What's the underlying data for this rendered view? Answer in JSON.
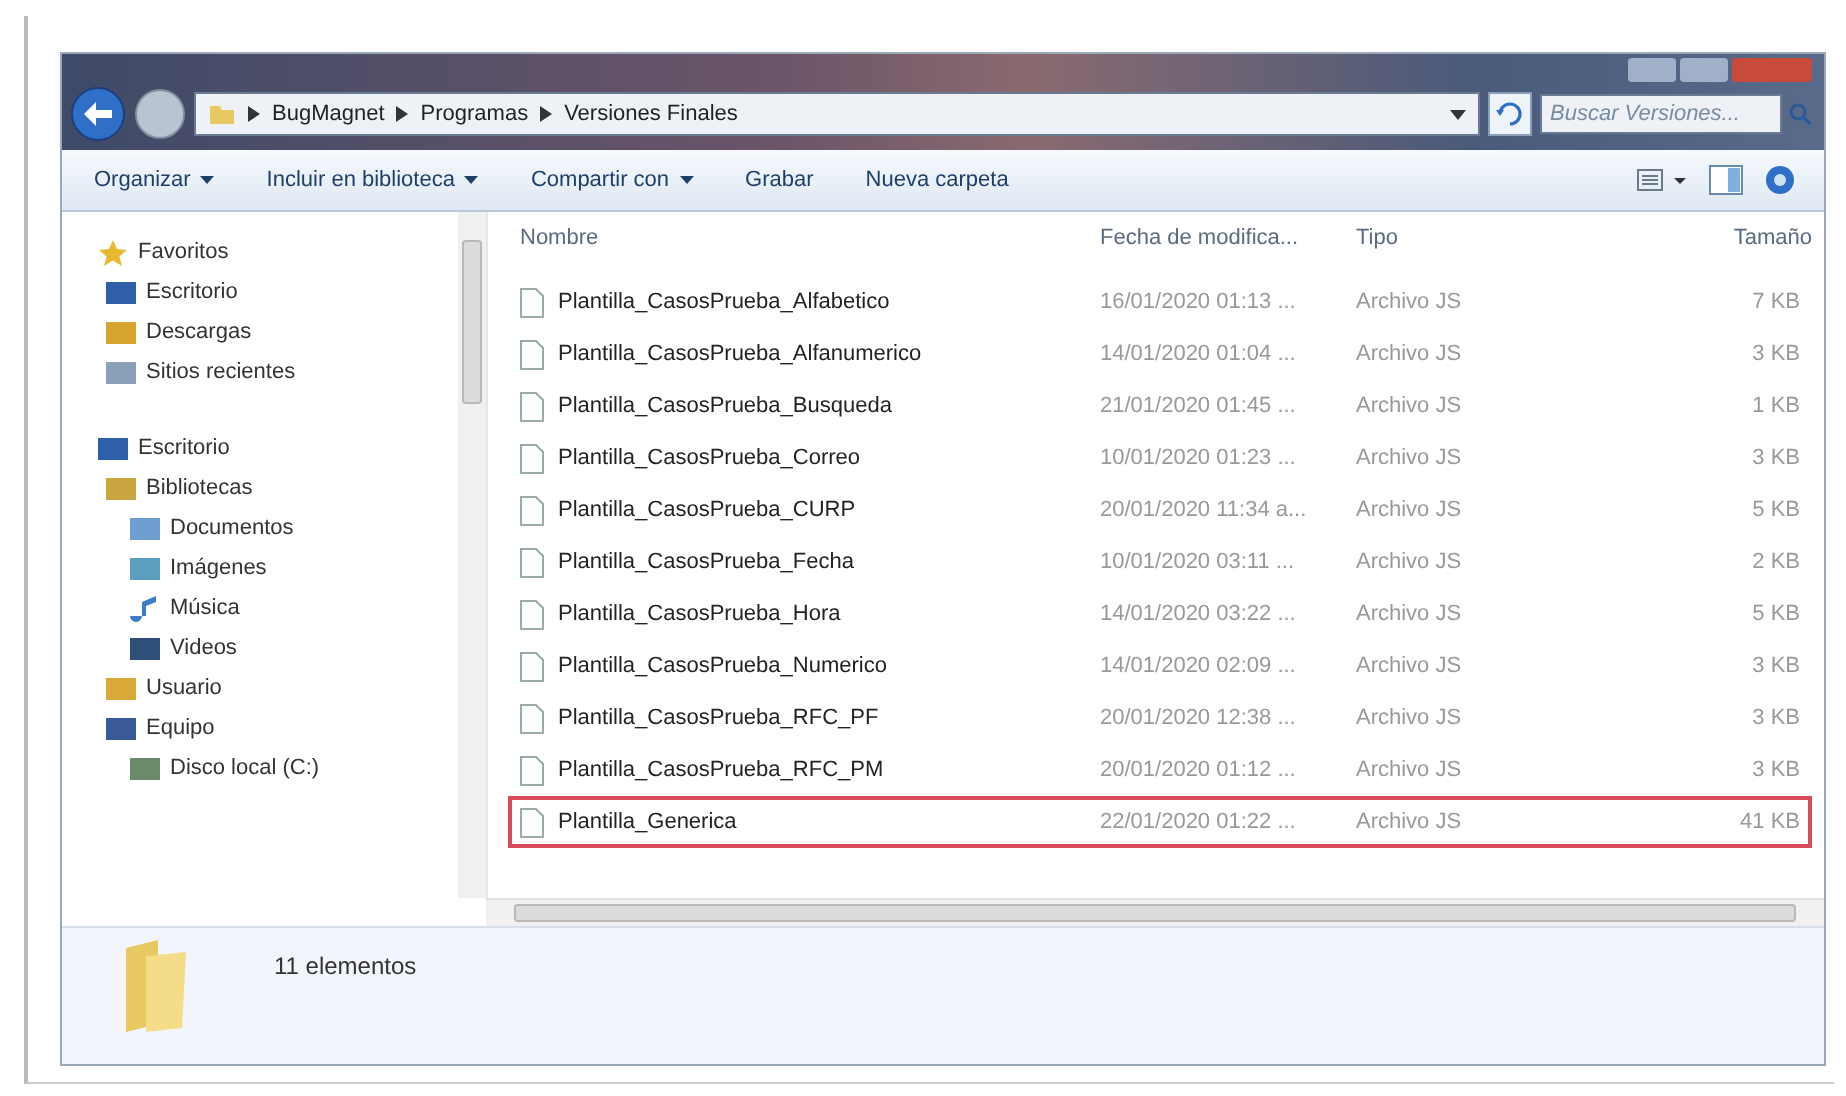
{
  "address_bar": {
    "breadcrumbs": [
      "BugMagnet",
      "Programas",
      "Versiones Finales"
    ]
  },
  "search": {
    "placeholder": "Buscar Versiones..."
  },
  "toolbar": {
    "buttons": [
      {
        "label": "Organizar",
        "dropdown": true
      },
      {
        "label": "Incluir en biblioteca",
        "dropdown": true
      },
      {
        "label": "Compartir con",
        "dropdown": true
      },
      {
        "label": "Grabar",
        "dropdown": false
      },
      {
        "label": "Nueva carpeta",
        "dropdown": false
      }
    ]
  },
  "sidebar": {
    "items": [
      {
        "label": "Favoritos",
        "kind": "star",
        "children": [
          {
            "label": "Escritorio",
            "kind": "desktop"
          },
          {
            "label": "Descargas",
            "kind": "download"
          },
          {
            "label": "Sitios recientes",
            "kind": "recent"
          }
        ]
      },
      {
        "label": "Escritorio",
        "kind": "desktop",
        "children": [
          {
            "label": "Bibliotecas",
            "kind": "library",
            "children": [
              {
                "label": "Documentos",
                "kind": "document"
              },
              {
                "label": "Imágenes",
                "kind": "images"
              },
              {
                "label": "Música",
                "kind": "music"
              },
              {
                "label": "Videos",
                "kind": "videos"
              }
            ]
          },
          {
            "label": "Usuario",
            "kind": "user"
          },
          {
            "label": "Equipo",
            "kind": "computer",
            "children": [
              {
                "label": "Disco local (C:)",
                "kind": "disk"
              }
            ]
          }
        ]
      }
    ]
  },
  "table": {
    "columns": [
      "Nombre",
      "Fecha de modifica...",
      "Tipo",
      "Tamaño"
    ],
    "rows": [
      {
        "name": "Plantilla_CasosPrueba_Alfabetico",
        "date": "16/01/2020 01:13 ...",
        "type": "Archivo JS",
        "size": "7 KB",
        "highlighted": false
      },
      {
        "name": "Plantilla_CasosPrueba_Alfanumerico",
        "date": "14/01/2020 01:04 ...",
        "type": "Archivo JS",
        "size": "3 KB",
        "highlighted": false
      },
      {
        "name": "Plantilla_CasosPrueba_Busqueda",
        "date": "21/01/2020 01:45 ...",
        "type": "Archivo JS",
        "size": "1 KB",
        "highlighted": false
      },
      {
        "name": "Plantilla_CasosPrueba_Correo",
        "date": "10/01/2020 01:23 ...",
        "type": "Archivo JS",
        "size": "3 KB",
        "highlighted": false
      },
      {
        "name": "Plantilla_CasosPrueba_CURP",
        "date": "20/01/2020 11:34 a...",
        "type": "Archivo JS",
        "size": "5 KB",
        "highlighted": false
      },
      {
        "name": "Plantilla_CasosPrueba_Fecha",
        "date": "10/01/2020 03:11 ...",
        "type": "Archivo JS",
        "size": "2 KB",
        "highlighted": false
      },
      {
        "name": "Plantilla_CasosPrueba_Hora",
        "date": "14/01/2020 03:22 ...",
        "type": "Archivo JS",
        "size": "5 KB",
        "highlighted": false
      },
      {
        "name": "Plantilla_CasosPrueba_Numerico",
        "date": "14/01/2020 02:09 ...",
        "type": "Archivo JS",
        "size": "3 KB",
        "highlighted": false
      },
      {
        "name": "Plantilla_CasosPrueba_RFC_PF",
        "date": "20/01/2020 12:38 ...",
        "type": "Archivo JS",
        "size": "3 KB",
        "highlighted": false
      },
      {
        "name": "Plantilla_CasosPrueba_RFC_PM",
        "date": "20/01/2020 01:12 ...",
        "type": "Archivo JS",
        "size": "3 KB",
        "highlighted": false
      },
      {
        "name": "Plantilla_Generica",
        "date": "22/01/2020 01:22 ...",
        "type": "Archivo JS",
        "size": "41 KB",
        "highlighted": true
      }
    ]
  },
  "status_bar": {
    "count": "11 elementos"
  }
}
